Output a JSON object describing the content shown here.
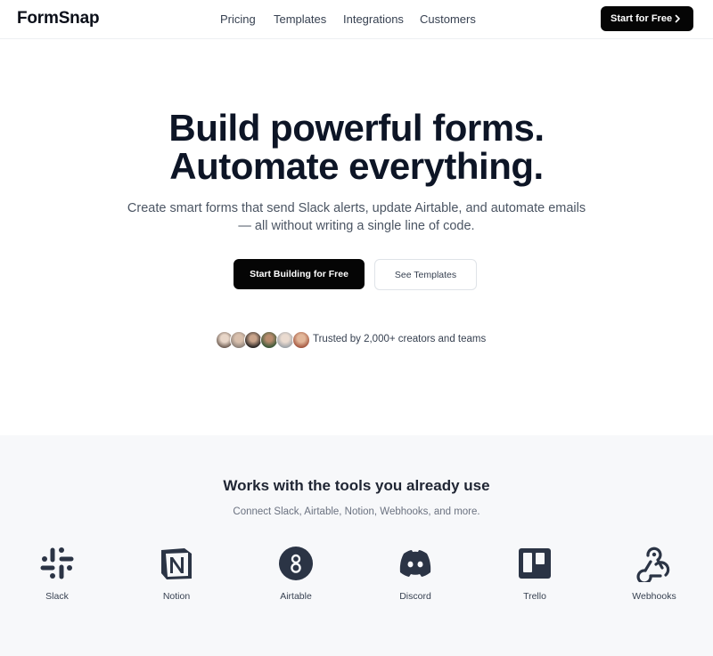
{
  "brand": {
    "name": "FormSnap"
  },
  "nav": {
    "links": [
      "Pricing",
      "Templates",
      "Integrations",
      "Customers"
    ],
    "cta_label": "Start for Free",
    "cta_icon": "chevron-right-icon"
  },
  "hero": {
    "title_line1": "Build powerful forms.",
    "title_line2": "Automate everything.",
    "subtitle_line1": "Create smart forms that send Slack alerts, update Airtable, and automate emails",
    "subtitle_line2": "— all without writing a single line of code.",
    "primary_cta": "Start Building for Free",
    "secondary_cta": "See Templates",
    "trust_text": "Trusted by 2,000+ creators and teams",
    "avatar_count": 6
  },
  "integrations": {
    "title": "Works with the tools you already use",
    "subtitle": "Connect Slack, Airtable, Notion, Webhooks, and more.",
    "tools": [
      {
        "label": "Slack",
        "icon": "slack-icon"
      },
      {
        "label": "Notion",
        "icon": "notion-icon"
      },
      {
        "label": "Airtable",
        "icon": "airtable-icon"
      },
      {
        "label": "Discord",
        "icon": "discord-icon"
      },
      {
        "label": "Trello",
        "icon": "trello-icon"
      },
      {
        "label": "Webhooks",
        "icon": "webhooks-icon"
      }
    ]
  },
  "colors": {
    "primary": "#050505",
    "heading": "#0d1526",
    "section_bg": "#f7f8fa",
    "icon": "#2b3445"
  }
}
